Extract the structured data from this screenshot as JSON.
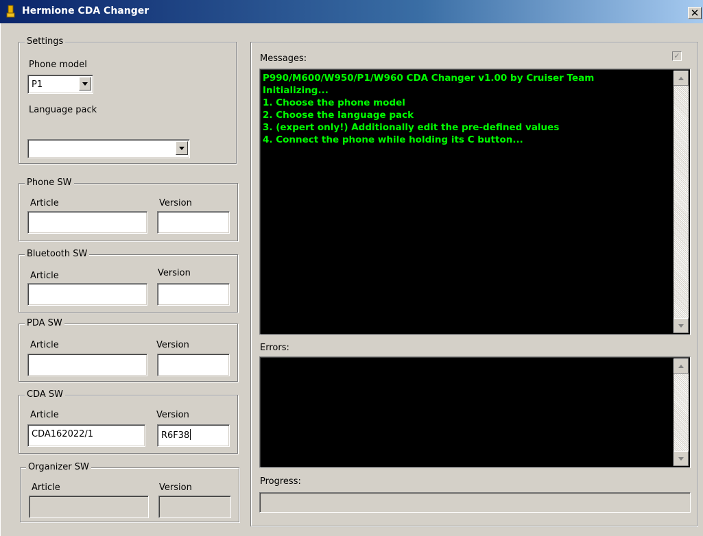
{
  "window": {
    "title": "Hermione CDA Changer",
    "close_glyph": "✕",
    "icon": "app-icon"
  },
  "settings": {
    "legend": "Settings",
    "phone_model_label": "Phone model",
    "phone_model_value": "P1",
    "language_pack_label": "Language pack",
    "language_pack_value": ""
  },
  "groups": {
    "phone": {
      "legend": "Phone SW",
      "article_label": "Article",
      "version_label": "Version",
      "article": "",
      "version": ""
    },
    "bluetooth": {
      "legend": "Bluetooth SW",
      "article_label": "Article",
      "version_label": "Version",
      "article": "",
      "version": ""
    },
    "pda": {
      "legend": "PDA SW",
      "article_label": "Article",
      "version_label": "Version",
      "article": "",
      "version": ""
    },
    "cda": {
      "legend": "CDA SW",
      "article_label": "Article",
      "version_label": "Version",
      "article": "CDA162022/1",
      "version": "R6F38"
    },
    "organizer": {
      "legend": "Organizer SW",
      "article_label": "Article",
      "version_label": "Version",
      "article": "",
      "version": ""
    }
  },
  "messages": {
    "label": "Messages:",
    "checkbox_checked": true,
    "check_glyph": "✓",
    "lines": [
      "P990/M600/W950/P1/W960 CDA Changer v1.00 by Cruiser Team",
      "Initializing...",
      "1. Choose the phone model",
      "2. Choose the language pack",
      "3. (expert only!) Additionally edit the pre-defined values",
      "4. Connect the phone while holding its C button..."
    ]
  },
  "errors": {
    "label": "Errors:"
  },
  "progress": {
    "label": "Progress:",
    "value": 0
  },
  "colors": {
    "console_bg": "#000000",
    "console_text": "#00ff00",
    "window_bg": "#d4d0c8",
    "titlebar": "#0a246a"
  }
}
